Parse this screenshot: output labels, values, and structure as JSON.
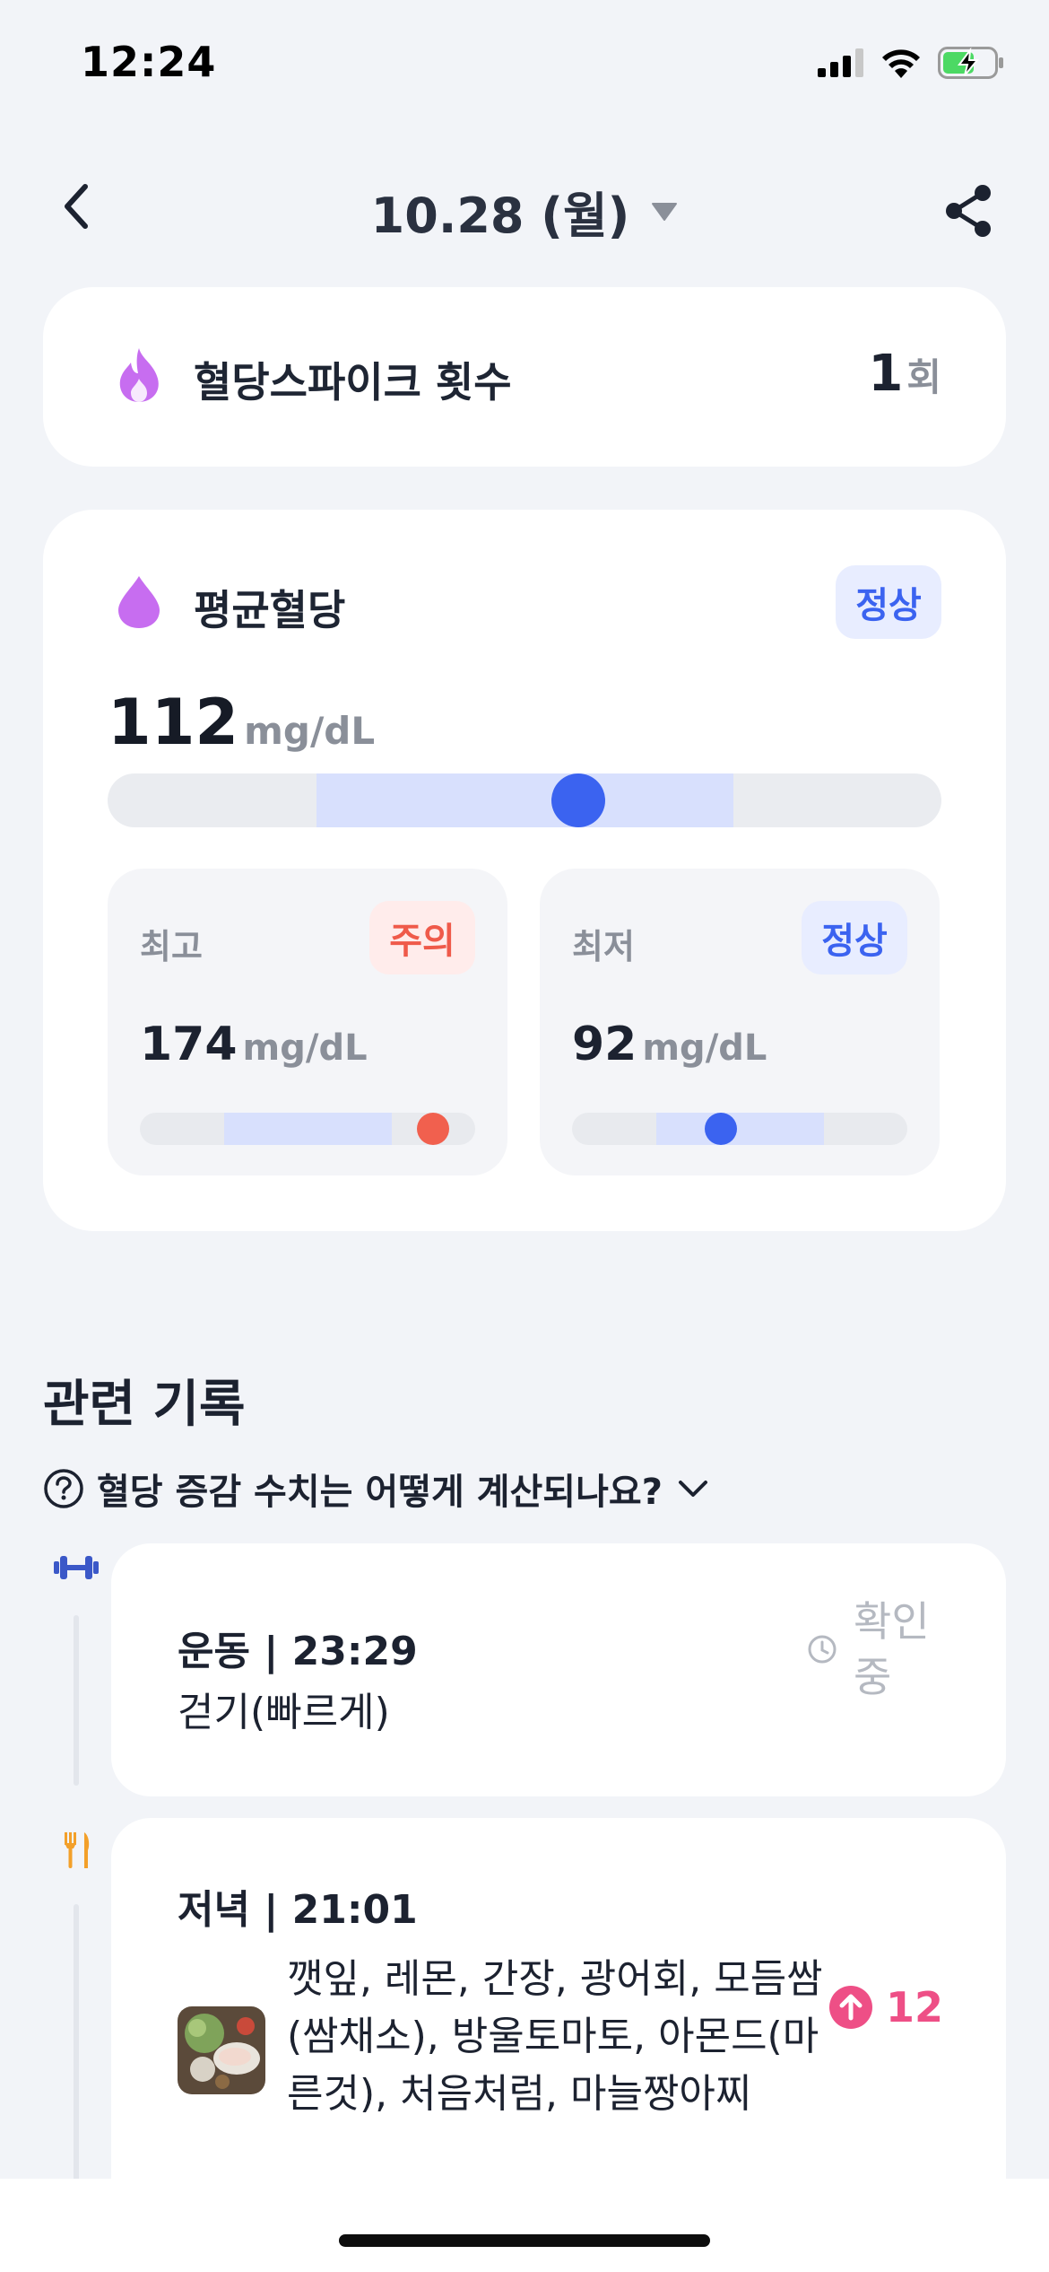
{
  "status_bar": {
    "time": "12:24"
  },
  "header": {
    "date": "10.28 (월)"
  },
  "spike": {
    "label": "혈당스파이크 횟수",
    "count": "1",
    "unit": "회"
  },
  "average": {
    "label": "평균혈당",
    "status": "정상",
    "value": "112",
    "unit": "mg/dL",
    "gauge": {
      "normal_range_start_frac": 0.25,
      "normal_range_end_frac": 0.75,
      "marker_frac": 0.565
    }
  },
  "max": {
    "label": "최고",
    "status": "주의",
    "value": "174",
    "unit": "mg/dL",
    "gauge": {
      "normal_range_start_frac": 0.25,
      "normal_range_end_frac": 0.75,
      "marker_frac": 0.875
    },
    "marker_color": "#f1604e"
  },
  "min": {
    "label": "최저",
    "status": "정상",
    "value": "92",
    "unit": "mg/dL",
    "gauge": {
      "normal_range_start_frac": 0.25,
      "normal_range_end_frac": 0.75,
      "marker_frac": 0.445
    },
    "marker_color": "#3b63f0"
  },
  "related": {
    "title": "관련 기록",
    "faq": "혈당 증감 수치는 어떻게 계산되나요?",
    "records": [
      {
        "type": "exercise",
        "icon": "dumbbell-icon",
        "header": "운동 | 23:29",
        "detail": "걷기(빠르게)",
        "status": "확인 중"
      },
      {
        "type": "dinner",
        "icon": "fork-knife-icon",
        "header": "저녁 | 21:01",
        "detail": "깻잎, 레몬, 간장, 광어회, 모듬쌈(쌈채소), 방울토마토, 아몬드(마른것), 처음처럼, 마늘짱아찌",
        "delta": "12"
      }
    ]
  },
  "colors": {
    "accent": "#3b63f0",
    "warn": "#ef5a4a",
    "spike": "#ee4f86",
    "icon_purple": "#c76df0"
  }
}
